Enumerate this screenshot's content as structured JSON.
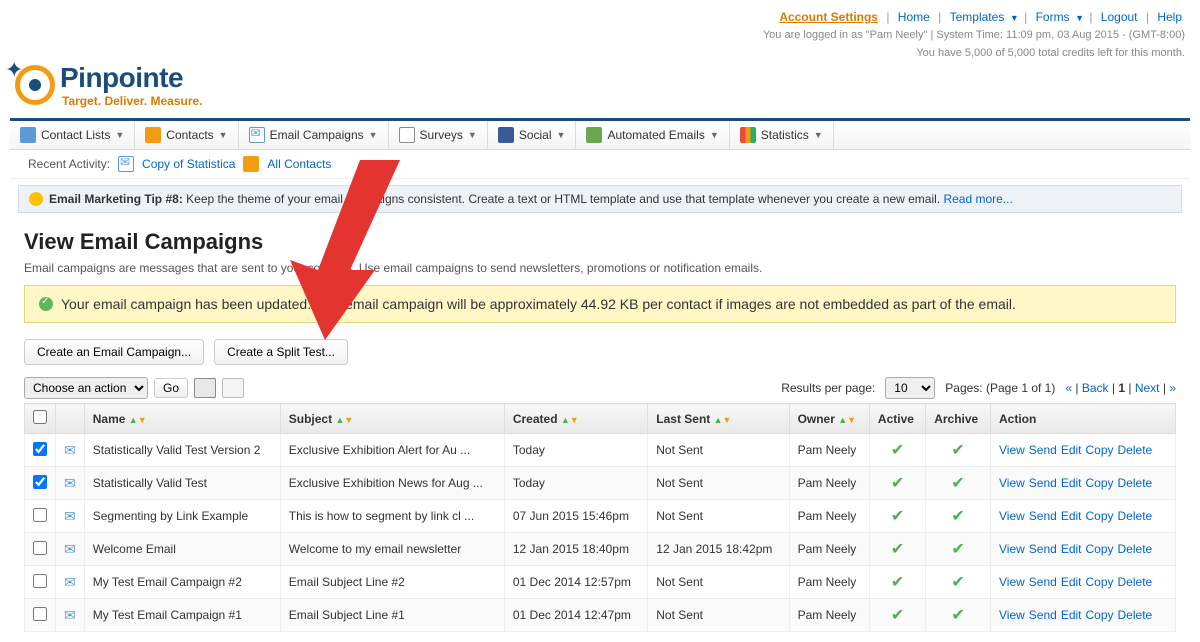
{
  "topnav": {
    "account": "Account Settings",
    "home": "Home",
    "templates": "Templates",
    "forms": "Forms",
    "logout": "Logout",
    "help": "Help",
    "logged": "You are logged in as \"Pam Neely\" | System Time: 11:09 pm, 03 Aug 2015 - (GMT-8:00)",
    "credits": "You have 5,000 of 5,000 total credits left for this month."
  },
  "logo": {
    "name": "Pinpointe",
    "tag": "Target. Deliver. Measure."
  },
  "nav": {
    "contactlists": "Contact Lists",
    "contacts": "Contacts",
    "campaigns": "Email Campaigns",
    "surveys": "Surveys",
    "social": "Social",
    "automated": "Automated Emails",
    "statistics": "Statistics"
  },
  "recent": {
    "label": "Recent Activity:",
    "a": "Copy of Statistica",
    "b": "All Contacts"
  },
  "tip": {
    "bold": "Email Marketing Tip #8:",
    "text": "Keep the theme of your email campaigns consistent. Create a text or HTML template and use that template whenever you create a new email.",
    "more": "Read more..."
  },
  "page": {
    "title": "View Email Campaigns",
    "desc": "Email campaigns are messages that are sent to your contacts. Use email campaigns to send newsletters, promotions or notification emails."
  },
  "alert": "Your email campaign has been updated. This email campaign will be approximately 44.92 KB per contact if images are not embedded as part of the email.",
  "btns": {
    "create": "Create an Email Campaign...",
    "split": "Create a Split Test..."
  },
  "toolbar": {
    "choose": "Choose an action",
    "go": "Go",
    "rpp_label": "Results per page:",
    "rpp": "10",
    "pages": "Pages: (Page 1 of 1)",
    "first": "«",
    "back": "Back",
    "cur": "1",
    "next": "Next",
    "last": "»"
  },
  "cols": {
    "name": "Name",
    "subject": "Subject",
    "created": "Created",
    "lastsent": "Last Sent",
    "owner": "Owner",
    "active": "Active",
    "archive": "Archive",
    "action": "Action"
  },
  "actions": {
    "view": "View",
    "send": "Send",
    "edit": "Edit",
    "copy": "Copy",
    "delete": "Delete"
  },
  "rows": [
    {
      "chk": true,
      "name": "Statistically Valid Test Version 2",
      "subject": "Exclusive Exhibition Alert for Au ...",
      "created": "Today",
      "lastsent": "Not Sent",
      "owner": "Pam Neely"
    },
    {
      "chk": true,
      "name": "Statistically Valid Test",
      "subject": "Exclusive Exhibition News for Aug ...",
      "created": "Today",
      "lastsent": "Not Sent",
      "owner": "Pam Neely"
    },
    {
      "chk": false,
      "name": "Segmenting by Link Example",
      "subject": "This is how to segment by link cl ...",
      "created": "07 Jun 2015 15:46pm",
      "lastsent": "Not Sent",
      "owner": "Pam Neely"
    },
    {
      "chk": false,
      "name": "Welcome Email",
      "subject": "Welcome to my email newsletter",
      "created": "12 Jan 2015 18:40pm",
      "lastsent": "12 Jan 2015 18:42pm",
      "owner": "Pam Neely"
    },
    {
      "chk": false,
      "name": "My Test Email Campaign #2",
      "subject": "Email Subject Line #2",
      "created": "01 Dec 2014 12:57pm",
      "lastsent": "Not Sent",
      "owner": "Pam Neely"
    },
    {
      "chk": false,
      "name": "My Test Email Campaign #1",
      "subject": "Email Subject Line #1",
      "created": "01 Dec 2014 12:47pm",
      "lastsent": "Not Sent",
      "owner": "Pam Neely"
    }
  ]
}
